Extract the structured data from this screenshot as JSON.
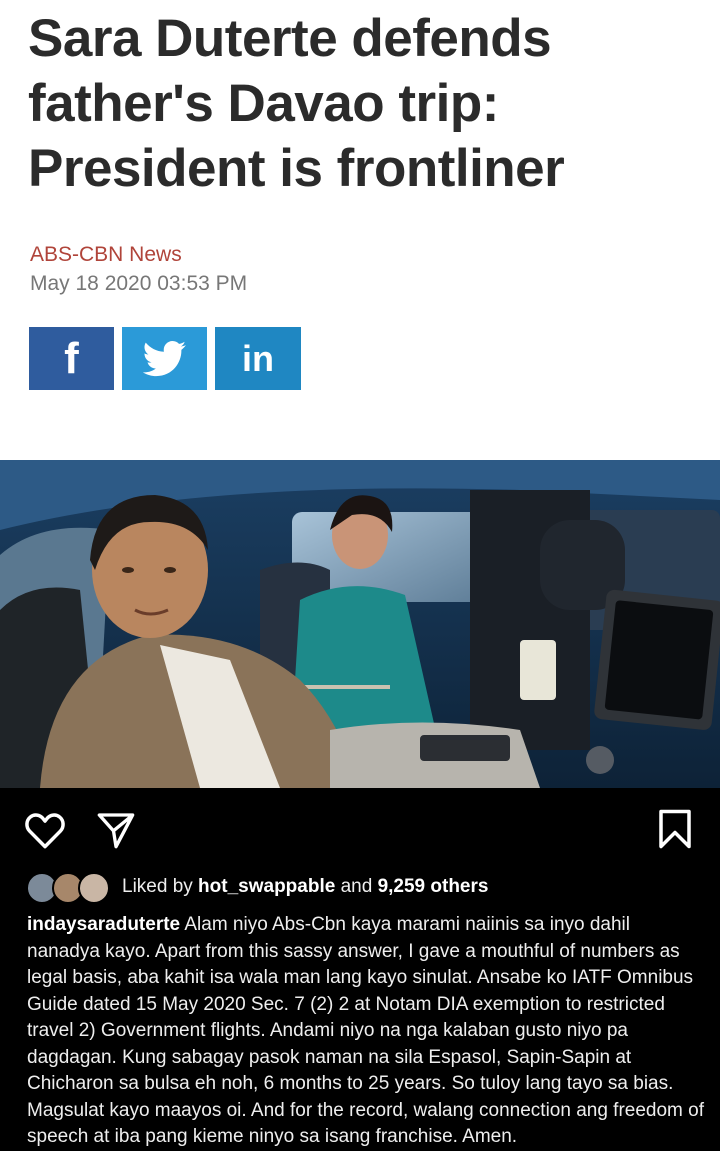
{
  "article": {
    "headline": "Sara Duterte defends father's Davao trip: President is frontliner",
    "source": "ABS-CBN News",
    "date": "May 18 2020 03:53 PM",
    "share_buttons": [
      {
        "label": "f",
        "icon": "facebook-icon",
        "color": "#2f5c9e"
      },
      {
        "label": "",
        "icon": "twitter-icon",
        "color": "#2b9ad8"
      },
      {
        "label": "in",
        "icon": "linkedin-icon",
        "color": "#1f87c2"
      }
    ]
  },
  "photo": {
    "icon": "photo-car-interior"
  },
  "instagram": {
    "actions": [
      "heart-icon",
      "share-direct-icon",
      "bookmark-icon"
    ],
    "likes": {
      "prefix": "Liked by ",
      "user": "hot_swappable",
      "middle": " and ",
      "count": "9,259 others"
    },
    "caption": {
      "username": "indaysaraduterte",
      "text": " Alam niyo Abs-Cbn kaya marami naiinis sa inyo dahil nanadya kayo. Apart from this sassy answer, I gave a mouthful of numbers as legal basis, aba kahit isa wala man lang kayo sinulat. Ansabe ko IATF Omnibus Guide dated 15 May 2020 Sec. 7 (2) 2 at Notam DIA exemption to restricted travel 2) Government flights. Andami niyo na nga kalaban gusto niyo pa dagdagan. Kung sabagay pasok naman na sila Espasol, Sapin-Sapin at Chicharon sa bulsa eh noh, 6 months to 25 years. So tuloy lang tayo sa bias. Magsulat kayo maayos oi. And for the record, walang connection ang freedom of speech at iba pang kieme ninyo sa isang franchise. Amen."
    },
    "colors": {
      "background": "#000000",
      "text": "#eeeeee"
    }
  }
}
